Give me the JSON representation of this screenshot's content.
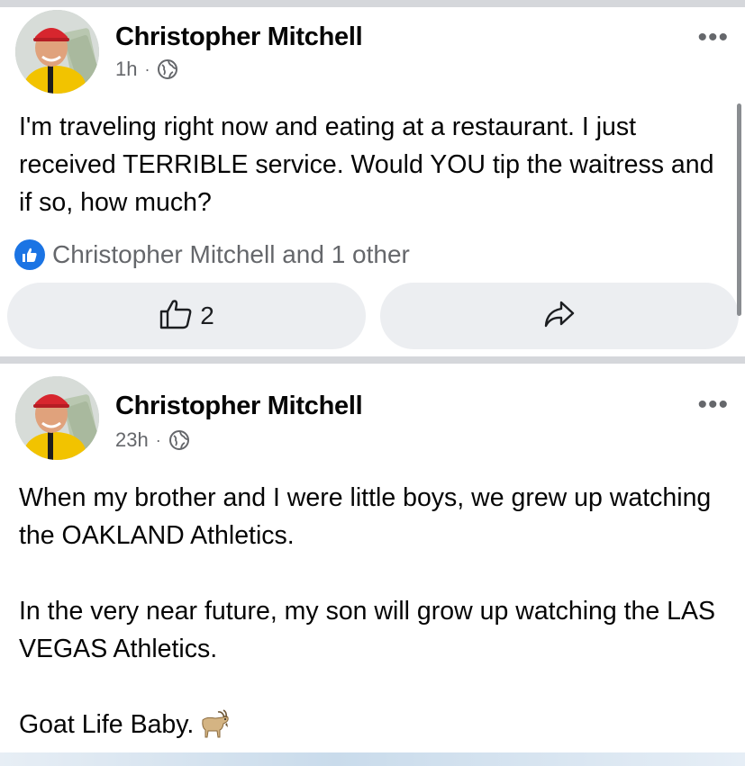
{
  "posts": [
    {
      "author": "Christopher Mitchell",
      "time": "1h",
      "separator": "·",
      "privacy_icon": "globe-icon",
      "more": "•••",
      "paragraphs": [
        "I'm traveling right now and eating at a restaurant. I just received TERRIBLE service. Would YOU tip the waitress and if so, how much?"
      ],
      "reactions_summary": "Christopher Mitchell and 1 other",
      "reaction_icon": "like-badge-icon",
      "like_count": "2",
      "share_icon": "share-arrow-icon"
    },
    {
      "author": "Christopher Mitchell",
      "time": "23h",
      "separator": "·",
      "privacy_icon": "globe-icon",
      "more": "•••",
      "paragraphs": [
        "When my brother and I were little boys, we grew up watching the OAKLAND Athletics.",
        "In the very near future, my son will grow up watching the LAS VEGAS Athletics.",
        "Goat Life Baby."
      ],
      "emoji_icon": "goat-icon"
    }
  ],
  "colors": {
    "text_primary": "#050505",
    "text_secondary": "#65676b",
    "like_blue": "#1b74e4",
    "button_bg": "#eceef1",
    "separator": "#d5d7db"
  }
}
